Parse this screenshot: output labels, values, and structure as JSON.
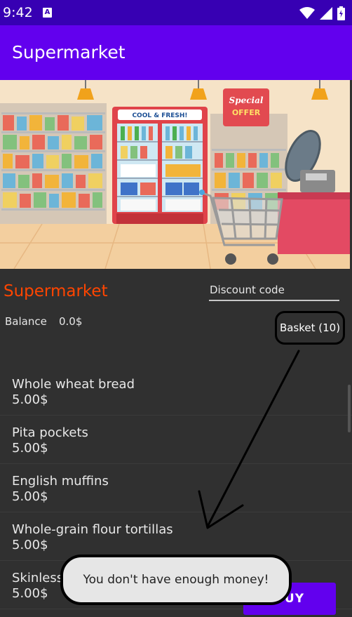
{
  "status_bar": {
    "time": "9:42",
    "notification_glyph": "A"
  },
  "app_bar": {
    "title": "Supermarket"
  },
  "banner": {
    "sign_cool": "COOL & FRESH!",
    "sign_special_1": "Special",
    "sign_special_2": "OFFER"
  },
  "main": {
    "store_name": "Supermarket",
    "discount_placeholder": "Discount code",
    "balance_label": "Balance",
    "balance_value": "0.0$",
    "basket_label": "Basket (10)"
  },
  "products": [
    {
      "name": "Whole wheat bread",
      "price": "5.00$"
    },
    {
      "name": "Pita pockets",
      "price": "5.00$"
    },
    {
      "name": "English muffins",
      "price": "5.00$"
    },
    {
      "name": "Whole-grain flour tortillas",
      "price": "5.00$"
    },
    {
      "name": "Skinless chicken breasts",
      "price": "5.00$"
    }
  ],
  "buy_label": "BUY",
  "toast": "You don't have enough money!",
  "colors": {
    "primary": "#6200ee",
    "primary_dark": "#3700b3",
    "accent": "#ff4500",
    "background": "#303030"
  }
}
